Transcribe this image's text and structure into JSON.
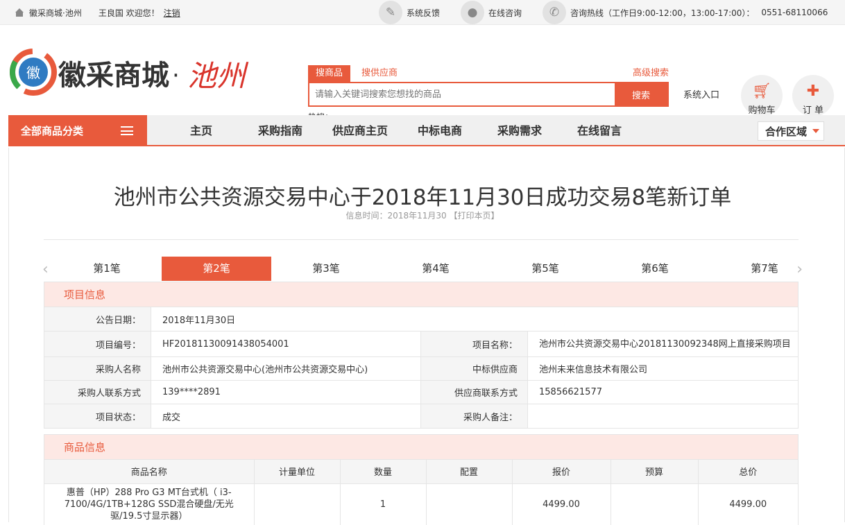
{
  "topbar": {
    "site_name": "徽采商城·池州",
    "welcome": "王良国 欢迎您！",
    "logout": "注销",
    "feedback": "系统反馈",
    "consult": "在线咨询",
    "hotline": "咨询热线（工作日9:00-12:00，13:00-17:00）：",
    "phone": "0551-68110066"
  },
  "header": {
    "logo_text": "徽采商城",
    "logo_city": "池州",
    "search_tab_goods": "搜商品",
    "search_tab_supplier": "搜供应商",
    "advanced_search": "高级搜索",
    "search_placeholder": "请输入关键词搜索您想找的商品",
    "search_button": "搜索",
    "hot_label": "热搜：",
    "system_entry": "系统入口",
    "cart": "购物车",
    "order": "订 单"
  },
  "nav": {
    "all_categories": "全部商品分类",
    "links": [
      "主页",
      "采购指南",
      "供应商主页",
      "中标电商",
      "采购需求",
      "在线留言"
    ],
    "coop_region": "合作区域"
  },
  "article": {
    "title": "池州市公共资源交易中心于2018年11月30日成功交易8笔新订单",
    "info_time": "信息时间：2018年11月30 【打印本页】",
    "tabs": [
      "第1笔",
      "第2笔",
      "第3笔",
      "第4笔",
      "第5笔",
      "第6笔",
      "第7笔"
    ],
    "active_tab": "第2笔"
  },
  "project_info": {
    "heading": "项目信息",
    "announce_date_label": "公告日期：",
    "announce_date": "2018年11月30日",
    "project_no_label": "项目编号：",
    "project_no": "HF20181130091438054001",
    "project_name_label": "项目名称：",
    "project_name": "池州市公共资源交易中心20181130092348网上直接采购项目",
    "buyer_label": "采购人名称",
    "buyer": "池州市公共资源交易中心(池州市公共资源交易中心)",
    "supplier_label": "中标供应商",
    "supplier": "池州未来信息技术有限公司",
    "buyer_contact_label": "采购人联系方式",
    "buyer_contact": "139****2891",
    "supplier_contact_label": "供应商联系方式",
    "supplier_contact": "15856621577",
    "status_label": "项目状态：",
    "status": "成交",
    "buyer_note_label": "采购人备注：",
    "buyer_note": ""
  },
  "goods_info": {
    "heading": "商品信息",
    "columns": [
      "商品名称",
      "计量单位",
      "数量",
      "配置",
      "报价",
      "预算",
      "总价"
    ],
    "rows": [
      {
        "name": "惠普（HP）288 Pro G3 MT台式机（ i3-7100/4G/1TB+128G SSD混合硬盘/无光驱/19.5寸显示器）",
        "unit": "",
        "qty": "1",
        "config": "",
        "price": "4499.00",
        "budget": "",
        "total": "4499.00"
      }
    ]
  },
  "colors": {
    "accent": "#e85a3c",
    "section_bg": "#fde8e4"
  }
}
